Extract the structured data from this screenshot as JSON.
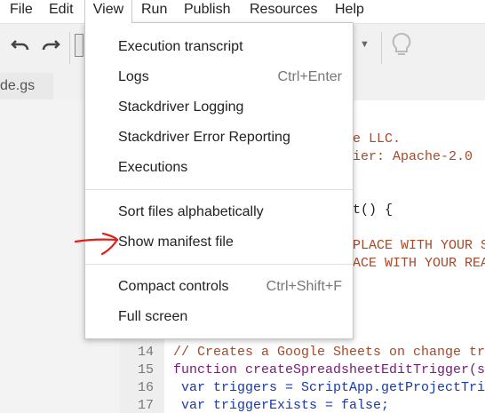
{
  "menubar": {
    "items": [
      {
        "label": "File"
      },
      {
        "label": "Edit"
      },
      {
        "label": "View"
      },
      {
        "label": "Run"
      },
      {
        "label": "Publish"
      },
      {
        "label": "Resources"
      },
      {
        "label": "Help"
      }
    ]
  },
  "file_tab": {
    "label": "de.gs"
  },
  "view_menu": {
    "groups": [
      {
        "items": [
          {
            "label": "Execution transcript",
            "shortcut": ""
          },
          {
            "label": "Logs",
            "shortcut": "Ctrl+Enter"
          },
          {
            "label": "Stackdriver Logging",
            "shortcut": ""
          },
          {
            "label": "Stackdriver Error Reporting",
            "shortcut": ""
          },
          {
            "label": "Executions",
            "shortcut": ""
          }
        ]
      },
      {
        "items": [
          {
            "label": "Sort files alphabetically",
            "shortcut": ""
          },
          {
            "label": "Show manifest file",
            "shortcut": ""
          }
        ]
      },
      {
        "items": [
          {
            "label": "Compact controls",
            "shortcut": "Ctrl+Shift+F"
          },
          {
            "label": "Full screen",
            "shortcut": ""
          }
        ]
      }
    ]
  },
  "code_partial": {
    "line_a": "e LLC.",
    "line_b": "ier: Apache-2.0",
    "line_c": "t() {",
    "line_d": "PLACE WITH YOUR S",
    "line_e": "ACE WITH YOUR REA"
  },
  "code_lines": [
    {
      "number": "14",
      "text": "// Creates a Google Sheets on change tr"
    },
    {
      "number": "15",
      "text": "function createSpreadsheetEditTrigger(s"
    },
    {
      "number": "16",
      "text": " var triggers = ScriptApp.getProjectTri"
    },
    {
      "number": "17",
      "text": " var triggerExists = false;"
    }
  ],
  "colors": {
    "comment": "#a54a2a",
    "keyword": "#7a1a7a",
    "annotation": "#e0201a"
  }
}
